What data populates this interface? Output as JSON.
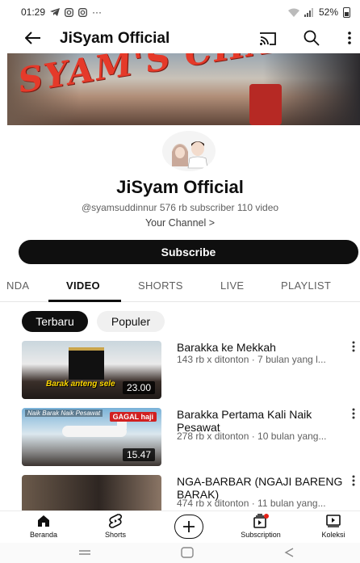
{
  "status_bar": {
    "time": "01:29",
    "notif_more": "···",
    "battery": "52%"
  },
  "header": {
    "title": "JiSyam Official"
  },
  "banner": {
    "text": "SYAM'S CHANNEL"
  },
  "channel": {
    "name": "JiSyam Official",
    "meta": "@syamsuddinnur  576 rb subscriber  110 video",
    "your_channel": "Your Channel  >"
  },
  "subscribe_label": "Subscribe",
  "tabs": [
    "NDA",
    "VIDEO",
    "SHORTS",
    "LIVE",
    "PLAYLIST"
  ],
  "active_tab": "VIDEO",
  "chips": {
    "selected": "Terbaru",
    "other": "Populer"
  },
  "videos": [
    {
      "title": "Barakka ke Mekkah",
      "meta": "143 rb x ditonton · 7 bulan yang l...",
      "duration": "23.00",
      "thumb_caption": "Barak anteng sele"
    },
    {
      "title": "Barakka Pertama Kali Naik Pesawat",
      "meta": "278 rb x ditonton · 10 bulan yang...",
      "duration": "15.47",
      "thumb_banner": "Naik Barak Naik Pesawat",
      "thumb_tag": "GAGAL haji"
    },
    {
      "title": "NGA-BARBAR (NGAJI BARENG BARAK)",
      "meta": "474 rb x ditonton · 11 bulan yang..."
    }
  ],
  "bottom_nav": {
    "home": "Beranda",
    "shorts": "Shorts",
    "subscription": "Subscription",
    "library": "Koleksi"
  },
  "colors": {
    "subscribe_bg": "#0f0f0f",
    "banner_text": "#e53a2a",
    "tag_red": "#d12020",
    "text_secondary": "#606060"
  }
}
